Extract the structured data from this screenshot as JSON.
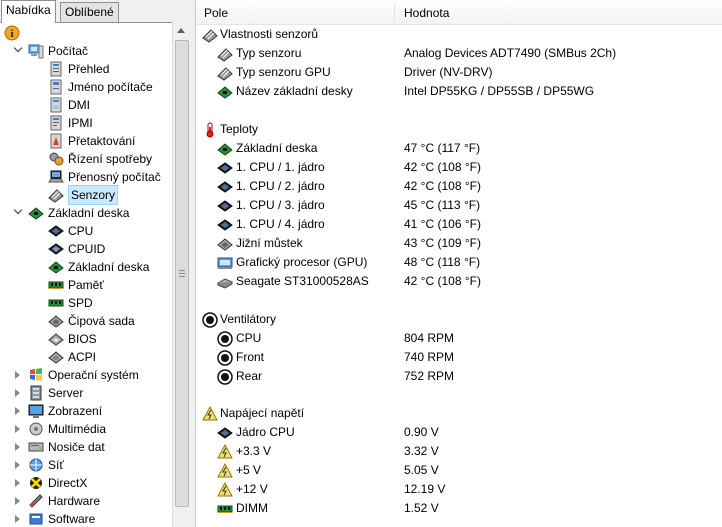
{
  "tabs": {
    "menu": "Nabídka",
    "favorites": "Oblíbené"
  },
  "tree": [
    {
      "label": "Počítač",
      "icon": "computer-icon",
      "level": 1,
      "expander": "open"
    },
    {
      "label": "Přehled",
      "icon": "computer-summary-icon",
      "level": 2
    },
    {
      "label": "Jméno počítače",
      "icon": "computer-name-icon",
      "level": 2
    },
    {
      "label": "DMI",
      "icon": "dmi-icon",
      "level": 2
    },
    {
      "label": "IPMI",
      "icon": "ipmi-icon",
      "level": 2
    },
    {
      "label": "Přetaktování",
      "icon": "overclock-icon",
      "level": 2
    },
    {
      "label": "Řízení spotřeby",
      "icon": "power-management-icon",
      "level": 2
    },
    {
      "label": "Přenosný počítač",
      "icon": "laptop-icon",
      "level": 2
    },
    {
      "label": "Senzory",
      "icon": "sensor-icon",
      "level": 2,
      "selected": true
    },
    {
      "label": "Základní deska",
      "icon": "motherboard-icon",
      "level": 1,
      "expander": "open"
    },
    {
      "label": "CPU",
      "icon": "cpu-icon",
      "level": 2
    },
    {
      "label": "CPUID",
      "icon": "cpuid-icon",
      "level": 2
    },
    {
      "label": "Základní deska",
      "icon": "motherboard-icon",
      "level": 2
    },
    {
      "label": "Paměť",
      "icon": "memory-icon",
      "level": 2
    },
    {
      "label": "SPD",
      "icon": "spd-icon",
      "level": 2
    },
    {
      "label": "Čipová sada",
      "icon": "chipset-icon",
      "level": 2
    },
    {
      "label": "BIOS",
      "icon": "bios-icon",
      "level": 2
    },
    {
      "label": "ACPI",
      "icon": "acpi-icon",
      "level": 2
    },
    {
      "label": "Operační systém",
      "icon": "windows-icon",
      "level": 1,
      "expander": "closed"
    },
    {
      "label": "Server",
      "icon": "server-icon",
      "level": 1,
      "expander": "closed"
    },
    {
      "label": "Zobrazení",
      "icon": "display-icon",
      "level": 1,
      "expander": "closed"
    },
    {
      "label": "Multimédia",
      "icon": "multimedia-icon",
      "level": 1,
      "expander": "closed"
    },
    {
      "label": "Nosiče dat",
      "icon": "storage-icon",
      "level": 1,
      "expander": "closed"
    },
    {
      "label": "Síť",
      "icon": "network-icon",
      "level": 1,
      "expander": "closed"
    },
    {
      "label": "DirectX",
      "icon": "directx-icon",
      "level": 1,
      "expander": "closed"
    },
    {
      "label": "Hardware",
      "icon": "hardware-icon",
      "level": 1,
      "expander": "closed"
    },
    {
      "label": "Software",
      "icon": "software-icon",
      "level": 1,
      "expander": "closed"
    }
  ],
  "header": {
    "col1": "Pole",
    "col2": "Hodnota"
  },
  "groups": [
    {
      "title": "Vlastnosti senzorů",
      "icon": "sensor-icon",
      "rows": [
        {
          "label": "Typ senzoru",
          "value": "Analog Devices ADT7490  (SMBus 2Ch)",
          "icon": "sensor-icon"
        },
        {
          "label": "Typ senzoru GPU",
          "value": "Driver  (NV-DRV)",
          "icon": "sensor-icon"
        },
        {
          "label": "Název základní desky",
          "value": "Intel DP55KG / DP55SB / DP55WG",
          "icon": "motherboard-icon"
        }
      ]
    },
    {
      "title": "Teploty",
      "icon": "thermometer-icon",
      "rows": [
        {
          "label": "Základní deska",
          "value": "47 °C  (117 °F)",
          "icon": "motherboard-icon"
        },
        {
          "label": "1. CPU / 1. jádro",
          "value": "42 °C  (108 °F)",
          "icon": "cpu-icon"
        },
        {
          "label": "1. CPU / 2. jádro",
          "value": "42 °C  (108 °F)",
          "icon": "cpu-icon"
        },
        {
          "label": "1. CPU / 3. jádro",
          "value": "45 °C  (113 °F)",
          "icon": "cpu-icon"
        },
        {
          "label": "1. CPU / 4. jádro",
          "value": "41 °C  (106 °F)",
          "icon": "cpu-icon"
        },
        {
          "label": "Jižní můstek",
          "value": "43 °C  (109 °F)",
          "icon": "chipset-icon"
        },
        {
          "label": "Grafický procesor (GPU)",
          "value": "48 °C  (118 °F)",
          "icon": "gpu-icon"
        },
        {
          "label": "Seagate ST31000528AS",
          "value": "42 °C  (108 °F)",
          "icon": "hdd-icon"
        }
      ]
    },
    {
      "title": "Ventilátory",
      "icon": "fan-icon",
      "rows": [
        {
          "label": "CPU",
          "value": "804 RPM",
          "icon": "fan-icon"
        },
        {
          "label": "Front",
          "value": "740 RPM",
          "icon": "fan-icon"
        },
        {
          "label": "Rear",
          "value": "752 RPM",
          "icon": "fan-icon"
        }
      ]
    },
    {
      "title": "Napájecí napětí",
      "icon": "voltage-icon",
      "rows": [
        {
          "label": "Jádro CPU",
          "value": "0.90 V",
          "icon": "cpu-icon"
        },
        {
          "label": "+3.3 V",
          "value": "3.32 V",
          "icon": "voltage-icon"
        },
        {
          "label": "+5 V",
          "value": "5.05 V",
          "icon": "voltage-icon"
        },
        {
          "label": "+12 V",
          "value": "12.19 V",
          "icon": "voltage-icon"
        },
        {
          "label": "DIMM",
          "value": "1.52 V",
          "icon": "memory-icon"
        }
      ]
    }
  ]
}
